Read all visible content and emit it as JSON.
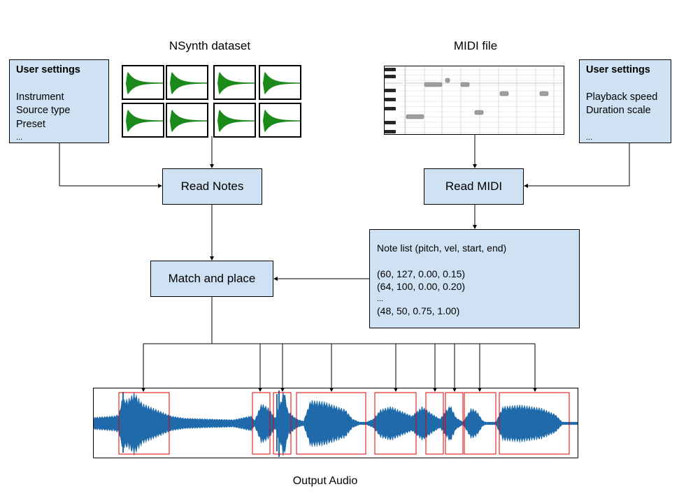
{
  "titles": {
    "nsynth": "NSynth dataset",
    "midi": "MIDI file",
    "output": "Output Audio"
  },
  "left_settings": {
    "heading": "User settings",
    "items": [
      "Instrument",
      "Source type",
      "Preset",
      "..."
    ]
  },
  "right_settings": {
    "heading": "User settings",
    "items": [
      "Playback speed",
      "Duration scale",
      "",
      "..."
    ]
  },
  "process": {
    "read_notes": "Read Notes",
    "read_midi": "Read MIDI",
    "match_place": "Match and place"
  },
  "note_list": {
    "header": "Note list (pitch, vel, start, end)",
    "rows": [
      "(60, 127, 0.00, 0.15)",
      "(64, 100, 0.00, 0.20)",
      "...",
      "(48, 50, 0.75, 1.00)"
    ]
  },
  "nsynth_samples": 8,
  "colors": {
    "box_fill": "#cfe2f3",
    "waveform_green": "#1a8a1a",
    "waveform_blue": "#1f6aab",
    "segment_red": "#e00000",
    "note_gray": "#9e9e9e"
  }
}
